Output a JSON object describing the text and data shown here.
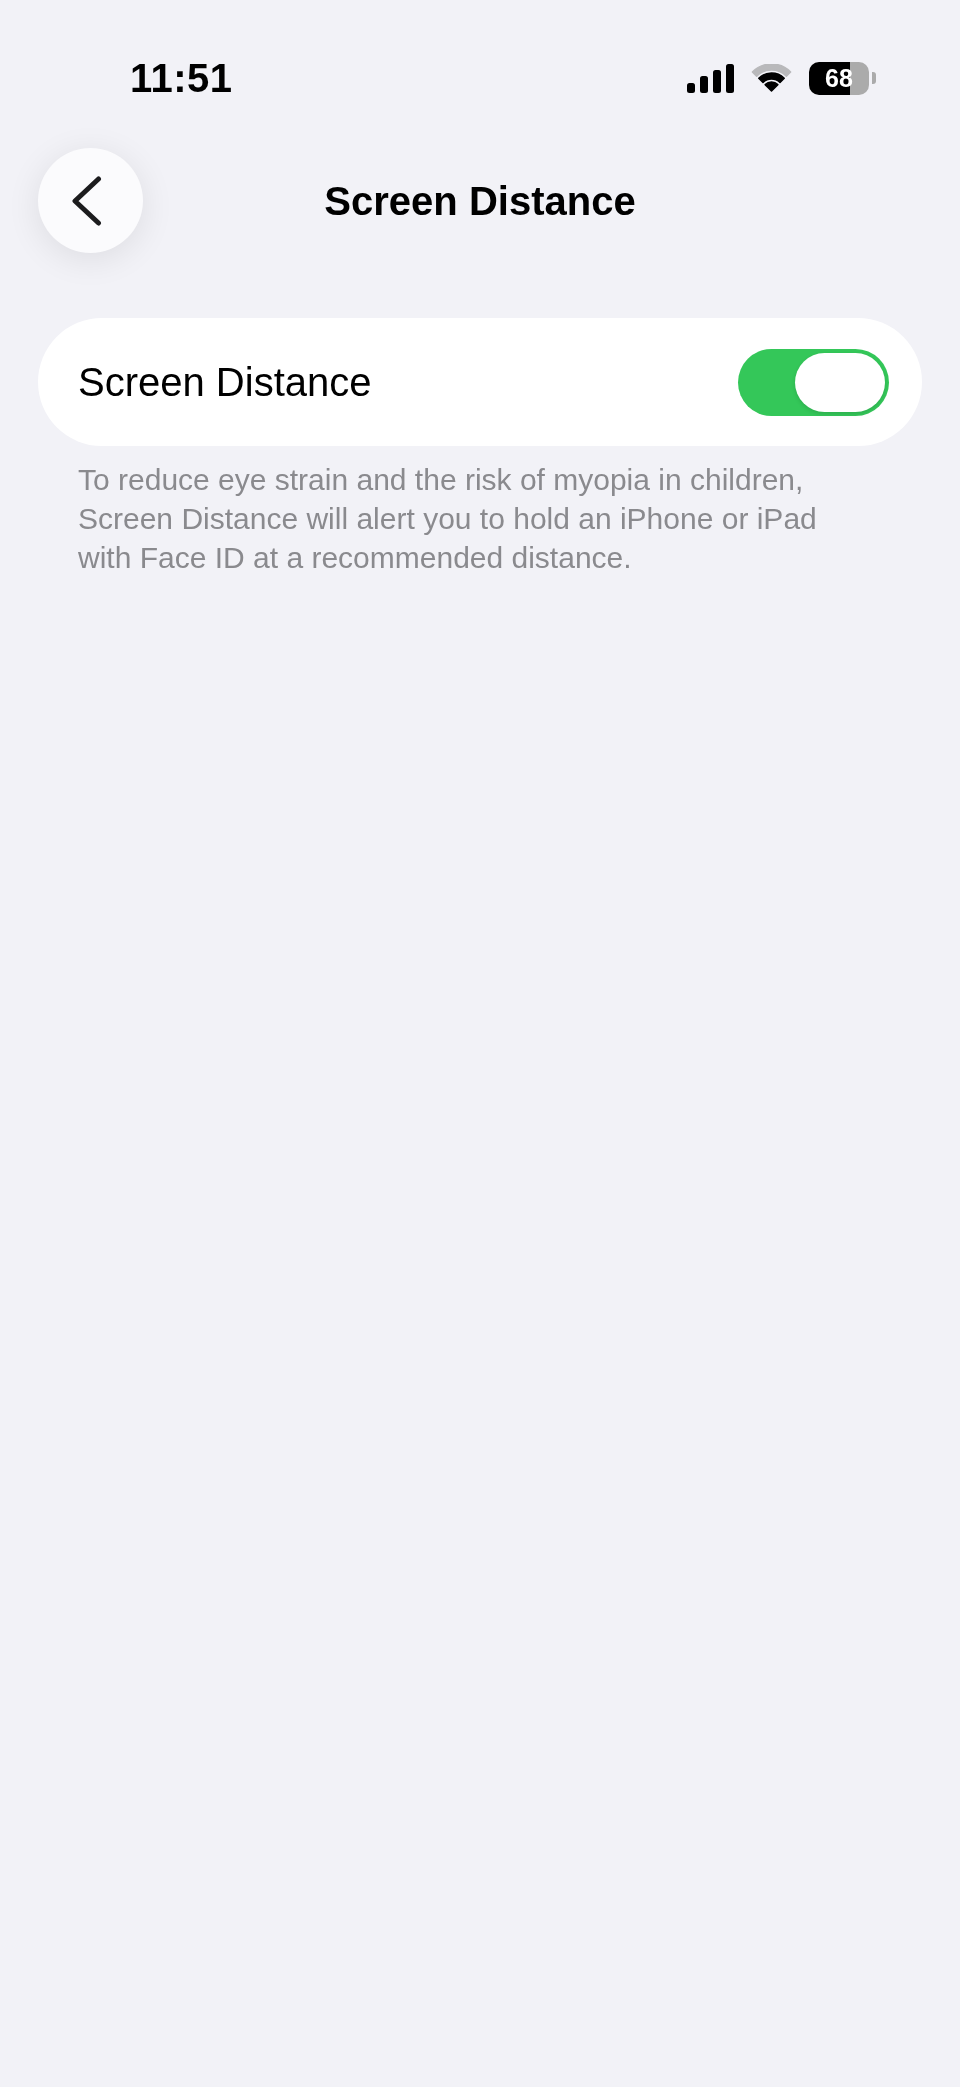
{
  "status_bar": {
    "time": "11:51",
    "battery": "68"
  },
  "nav_bar": {
    "title": "Screen Distance"
  },
  "settings_group": {
    "rows": [
      {
        "label": "Screen Distance",
        "on": true
      }
    ],
    "footer": "To reduce eye strain and the risk of myopia in children, Screen Distance will alert you to hold an iPhone or iPad with Face ID at a recommended distance."
  }
}
